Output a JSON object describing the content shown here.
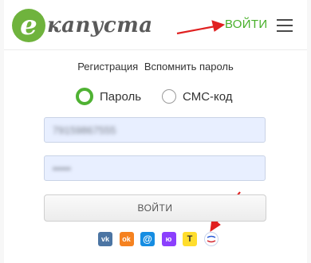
{
  "header": {
    "logo_letter": "e",
    "logo_text": "капуста",
    "login_label": "ВОЙТИ",
    "menu_icon": "hamburger-menu-icon"
  },
  "links": {
    "register": "Регистрация",
    "recover": "Вспомнить пароль"
  },
  "auth_mode": {
    "options": [
      {
        "label": "Пароль",
        "selected": true
      },
      {
        "label": "СМС-код",
        "selected": false
      }
    ]
  },
  "form": {
    "phone_value_blurred": "79159867555",
    "password_value_blurred": "•••••",
    "submit_label": "ВОЙТИ"
  },
  "socials": {
    "vk": "vk",
    "ok": "ok",
    "mail": "@",
    "yoo": "ю",
    "tinkoff": "T",
    "gosuslugi": "госуслуги"
  },
  "colors": {
    "brand_green": "#4fb233",
    "input_bg": "#e8efff",
    "arrow_red": "#e02020"
  }
}
